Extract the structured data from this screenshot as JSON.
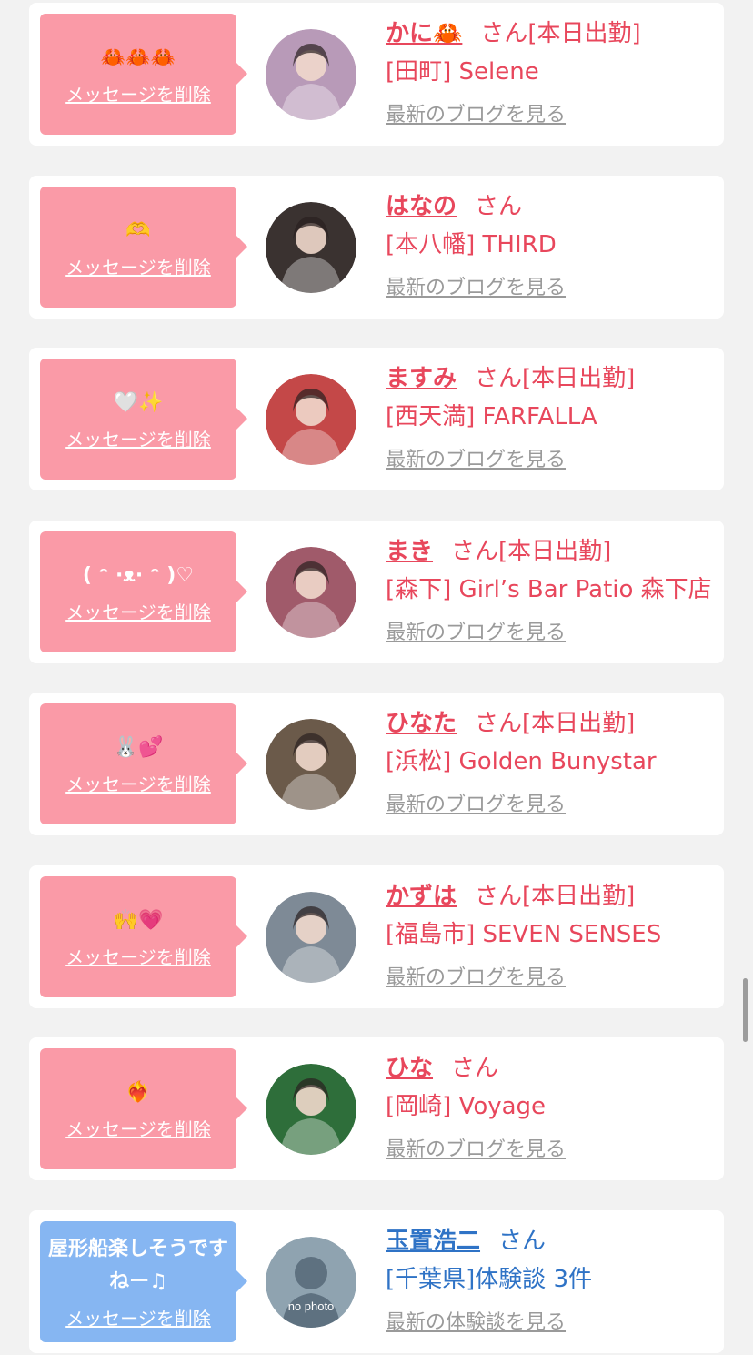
{
  "delete_label": "メッセージを削除",
  "colors": {
    "bubble_pink": "#fa9aa7",
    "bubble_blue": "#86b6f2",
    "name_pink": "#e8475c",
    "name_blue": "#2f73c6",
    "link_gray": "#9a9a9a",
    "background": "#f2f2f2"
  },
  "cards": [
    {
      "message": "🦀🦀🦀",
      "name": "かに🦀",
      "suffix": "さん[本日出勤]",
      "shop": "[田町] Selene",
      "link": "最新のブログを見る",
      "avatar_icon": "girl-photo-avatar",
      "avatar_color": "#b89ab8",
      "theme": "pink"
    },
    {
      "message": "🫶",
      "name": "はなの",
      "suffix": "さん",
      "shop": "[本八幡] THIRD",
      "link": "最新のブログを見る",
      "avatar_icon": "girl-photo-avatar",
      "avatar_color": "#3a3230",
      "theme": "pink"
    },
    {
      "message": "🤍✨",
      "name": "ますみ",
      "suffix": "さん[本日出勤]",
      "shop": "[西天満] FARFALLA",
      "link": "最新のブログを見る",
      "avatar_icon": "girl-photo-avatar",
      "avatar_color": "#c44848",
      "theme": "pink"
    },
    {
      "message": "( ᵔ ·ᴥ· ᵔ )♡",
      "name": "まき",
      "suffix": "さん[本日出勤]",
      "shop": "[森下] Girl’s Bar Patio 森下店",
      "link": "最新のブログを見る",
      "avatar_icon": "girl-photo-avatar",
      "avatar_color": "#a05a6a",
      "theme": "pink"
    },
    {
      "message": "🐰💕",
      "name": "ひなた",
      "suffix": "さん[本日出勤]",
      "shop": "[浜松] Golden Bunystar",
      "link": "最新のブログを見る",
      "avatar_icon": "girl-photo-avatar",
      "avatar_color": "#6b5a4a",
      "theme": "pink"
    },
    {
      "message": "🙌💗",
      "name": "かずは",
      "suffix": "さん[本日出勤]",
      "shop": "[福島市] SEVEN SENSES",
      "link": "最新のブログを見る",
      "avatar_icon": "girl-photo-avatar",
      "avatar_color": "#7e8a96",
      "theme": "pink"
    },
    {
      "message": "❤️‍🔥",
      "name": "ひな",
      "suffix": "さん",
      "shop": "[岡崎] Voyage",
      "link": "最新のブログを見る",
      "avatar_icon": "girl-photo-avatar",
      "avatar_color": "#2e6e3a",
      "theme": "pink"
    },
    {
      "message": "屋形船楽しそうですねー♫",
      "name": "玉置浩二",
      "suffix": "さん",
      "shop": "[千葉県]体験談 3件",
      "link": "最新の体験談を見る",
      "avatar_icon": "no-photo-avatar",
      "avatar_color": "#8fa3b0",
      "avatar_text": "no photo",
      "theme": "blue"
    }
  ]
}
